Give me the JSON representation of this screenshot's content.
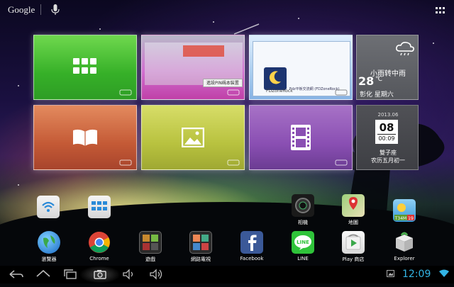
{
  "search": {
    "logo_text": "Google"
  },
  "tiles": {
    "browser_dialog_text": "進設PIN碼本裝置",
    "blue_caption": "Fdz平板交流網 (FDZoneRock)",
    "blue_logo_text": "FDZoneRock"
  },
  "weather": {
    "condition": "小雨转中雨",
    "temperature": "28",
    "unit": "℃",
    "location_day": "彰化 星期六"
  },
  "calendar": {
    "month": "2013.06",
    "day": "08",
    "time": "00:09",
    "weekday": "雙子座",
    "lunar": "农历五月初一"
  },
  "widgets": {
    "wifi_label": "",
    "power_label": ""
  },
  "upper_apps": [
    {
      "label": "相機"
    },
    {
      "label": "地圖"
    },
    {
      "label": ""
    }
  ],
  "dock_apps": [
    {
      "label": "瀏覽器"
    },
    {
      "label": "Chrome"
    },
    {
      "label": "遊戲"
    },
    {
      "label": "網路電視"
    },
    {
      "label": "Facebook"
    },
    {
      "label": "LINE"
    },
    {
      "label": "Play 商店"
    },
    {
      "label": "Explorer"
    }
  ],
  "weather_badge": {
    "top": "T34M",
    "bottom": "19"
  },
  "statusbar": {
    "time": "12:09"
  },
  "colors": {
    "clock": "#33b5e5",
    "green_tile": "#36b028",
    "purple_tile": "#8a4fb3"
  }
}
